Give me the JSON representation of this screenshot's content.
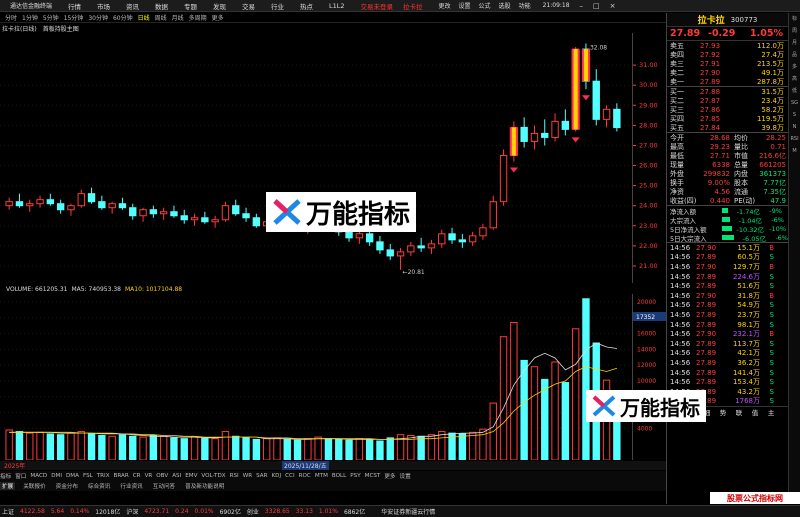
{
  "menu": {
    "app": "通达信金融终端",
    "items": [
      "行情",
      "市场",
      "资讯",
      "数据",
      "专题",
      "发现",
      "交易",
      "行业",
      "热点",
      "L1L2"
    ],
    "trade": "交易未登录",
    "stock": "拉卡拉",
    "right": [
      "更改",
      "设置",
      "公式",
      "选股",
      "功能"
    ],
    "time": "21:09:18"
  },
  "periods": [
    "分时",
    "1分钟",
    "5分钟",
    "15分钟",
    "30分钟",
    "60分钟",
    "日线",
    "周线",
    "月线",
    "多周期",
    "更多"
  ],
  "title": {
    "name": "拉卡拉(日线)",
    "tag": "首板持股主图"
  },
  "volume_header": {
    "vol": "VOLUME: 661205.31",
    "ma5": "MA5: 740953.38",
    "ma10": "MA10: 1017104.88"
  },
  "chart_data": [
    {
      "type": "candlestick",
      "title": "拉卡拉(日线)",
      "y_ticks": [
        31,
        30,
        29,
        28,
        27,
        26,
        25,
        24,
        23,
        22,
        21
      ],
      "ylim": [
        20.4,
        32.6
      ],
      "max_label": "32.08",
      "min_label": "20.81",
      "dates_label": [
        "2025年",
        "2025/11/28/五"
      ],
      "candles": [
        [
          24.0,
          24.4,
          23.8,
          24.2
        ],
        [
          24.2,
          24.6,
          23.9,
          24.0
        ],
        [
          24.0,
          24.3,
          23.7,
          24.1
        ],
        [
          24.1,
          24.5,
          23.9,
          24.3
        ],
        [
          24.3,
          24.6,
          24.0,
          24.1
        ],
        [
          24.1,
          24.3,
          23.6,
          23.8
        ],
        [
          23.8,
          24.1,
          23.5,
          24.0
        ],
        [
          24.0,
          24.8,
          23.9,
          24.6
        ],
        [
          24.6,
          24.9,
          24.1,
          24.2
        ],
        [
          24.2,
          24.5,
          23.8,
          23.9
        ],
        [
          23.9,
          24.2,
          23.6,
          24.1
        ],
        [
          24.1,
          24.4,
          23.8,
          23.9
        ],
        [
          23.9,
          24.1,
          23.3,
          23.5
        ],
        [
          23.5,
          23.9,
          23.2,
          23.8
        ],
        [
          23.8,
          24.0,
          23.4,
          23.6
        ],
        [
          23.6,
          23.9,
          23.3,
          23.7
        ],
        [
          23.7,
          24.0,
          23.4,
          23.5
        ],
        [
          23.5,
          23.8,
          23.1,
          23.3
        ],
        [
          23.3,
          23.6,
          23.0,
          23.4
        ],
        [
          23.4,
          23.7,
          23.1,
          23.2
        ],
        [
          23.2,
          23.5,
          22.9,
          23.3
        ],
        [
          23.3,
          24.2,
          23.2,
          24.0
        ],
        [
          24.0,
          24.3,
          23.5,
          23.6
        ],
        [
          23.6,
          23.9,
          23.2,
          23.4
        ],
        [
          23.4,
          23.6,
          22.9,
          23.0
        ],
        [
          23.0,
          23.4,
          22.8,
          23.2
        ],
        [
          23.2,
          23.5,
          22.9,
          23.3
        ],
        [
          23.3,
          23.6,
          23.0,
          23.1
        ],
        [
          23.1,
          23.4,
          22.7,
          22.9
        ],
        [
          22.9,
          23.3,
          22.6,
          23.1
        ],
        [
          23.1,
          23.6,
          22.9,
          23.4
        ],
        [
          23.4,
          23.7,
          23.0,
          23.2
        ],
        [
          23.2,
          23.4,
          22.5,
          22.7
        ],
        [
          22.7,
          23.0,
          22.2,
          22.4
        ],
        [
          22.4,
          22.8,
          22.1,
          22.6
        ],
        [
          22.6,
          22.9,
          22.0,
          22.2
        ],
        [
          22.2,
          22.5,
          21.6,
          21.8
        ],
        [
          21.8,
          22.1,
          21.3,
          21.5
        ],
        [
          21.5,
          21.9,
          20.81,
          21.7
        ],
        [
          21.7,
          22.2,
          21.5,
          22.0
        ],
        [
          22.0,
          22.4,
          21.7,
          21.9
        ],
        [
          21.9,
          22.3,
          21.6,
          22.1
        ],
        [
          22.1,
          22.8,
          21.9,
          22.6
        ],
        [
          22.6,
          22.9,
          22.1,
          22.3
        ],
        [
          22.3,
          22.6,
          21.9,
          22.2
        ],
        [
          22.2,
          22.7,
          22.0,
          22.5
        ],
        [
          22.5,
          23.1,
          22.3,
          22.9
        ],
        [
          22.9,
          24.5,
          22.8,
          24.2
        ],
        [
          24.2,
          26.8,
          24.0,
          26.5
        ],
        [
          26.5,
          28.2,
          26.2,
          27.9
        ],
        [
          27.9,
          28.4,
          26.9,
          27.2
        ],
        [
          27.2,
          28.0,
          26.8,
          27.6
        ],
        [
          27.6,
          28.3,
          27.0,
          27.4
        ],
        [
          27.4,
          28.6,
          27.2,
          28.2
        ],
        [
          28.2,
          28.8,
          27.5,
          27.8
        ],
        [
          27.8,
          31.9,
          27.7,
          31.8
        ],
        [
          31.8,
          32.08,
          29.8,
          30.2
        ],
        [
          30.2,
          30.8,
          28.0,
          28.3
        ],
        [
          28.3,
          29.0,
          27.9,
          28.8
        ],
        [
          28.8,
          29.1,
          27.7,
          27.89
        ]
      ]
    },
    {
      "type": "bar",
      "title": "VOLUME",
      "y_ticks": [
        20000,
        18000,
        16000,
        14000,
        12000,
        10000,
        8000,
        6000,
        4000
      ],
      "ylim": [
        0,
        21000
      ],
      "tag_value": "17352",
      "values": [
        3800,
        3600,
        3400,
        3500,
        3300,
        3200,
        3400,
        3600,
        3300,
        3100,
        3000,
        3200,
        3000,
        2900,
        3100,
        3000,
        2800,
        2700,
        2900,
        2800,
        2700,
        3600,
        3000,
        2800,
        2600,
        2700,
        2800,
        2600,
        2500,
        2700,
        2900,
        2700,
        2600,
        2500,
        2700,
        2600,
        2400,
        2800,
        3200,
        3100,
        3000,
        3200,
        3600,
        3400,
        3300,
        3500,
        3900,
        7200,
        15600,
        17400,
        12600,
        11800,
        10200,
        12400,
        9800,
        16600,
        20400,
        14800,
        10100,
        8600
      ],
      "ma5": [
        3500,
        3500,
        3500,
        3500,
        3500,
        3400,
        3400,
        3400,
        3400,
        3300,
        3300,
        3300,
        3200,
        3100,
        3000,
        3000,
        2900,
        2900,
        2900,
        2800,
        2800,
        2900,
        2900,
        2900,
        2900,
        2700,
        2700,
        2700,
        2600,
        2600,
        2700,
        2700,
        2700,
        2600,
        2600,
        2600,
        2600,
        2600,
        2700,
        2800,
        3000,
        3000,
        3200,
        3300,
        3400,
        3400,
        3500,
        4200,
        6600,
        9500,
        11300,
        12900,
        13500,
        12900,
        11400,
        12100,
        13900,
        14800,
        14300,
        14100
      ],
      "ma10": [
        3500,
        3500,
        3500,
        3500,
        3500,
        3500,
        3500,
        3400,
        3400,
        3400,
        3400,
        3300,
        3300,
        3200,
        3200,
        3100,
        3100,
        3000,
        3000,
        2900,
        2900,
        2900,
        2900,
        2900,
        2900,
        2800,
        2800,
        2800,
        2700,
        2700,
        2700,
        2700,
        2700,
        2700,
        2700,
        2700,
        2600,
        2600,
        2600,
        2600,
        2700,
        2700,
        2800,
        2900,
        3000,
        3100,
        3200,
        3600,
        4700,
        6200,
        7300,
        8200,
        8900,
        9600,
        10000,
        11200,
        11800,
        11500,
        11200,
        11600
      ]
    }
  ],
  "indicators": [
    "指标",
    "窗口",
    "MACD",
    "DMI",
    "DMA",
    "FSL",
    "TRIX",
    "BRAR",
    "CR",
    "VR",
    "OBV",
    "ASI",
    "EMV",
    "VOL-TDX",
    "RSI",
    "WR",
    "SAR",
    "KDJ",
    "CCI",
    "ROC",
    "MTM",
    "BOLL",
    "PSY",
    "MCST",
    "更多",
    "设置"
  ],
  "tabs": [
    "扩展",
    "关联报价",
    "资金分布",
    "综合资讯",
    "行业资讯",
    "互动问答",
    "普及新功能说明"
  ],
  "quote": {
    "name": "拉卡拉",
    "code": "300773",
    "price": "27.89",
    "change": "-0.29",
    "pct": "1.05%",
    "asks": [
      [
        "卖五",
        "27.93",
        "112.0万"
      ],
      [
        "卖四",
        "27.92",
        "27.4万"
      ],
      [
        "卖三",
        "27.91",
        "213.5万"
      ],
      [
        "卖二",
        "27.90",
        "49.1万"
      ],
      [
        "卖一",
        "27.89",
        "287.8万"
      ]
    ],
    "bids": [
      [
        "买一",
        "27.88",
        "31.5万"
      ],
      [
        "买二",
        "27.87",
        "23.4万"
      ],
      [
        "买三",
        "27.86",
        "58.2万"
      ],
      [
        "买四",
        "27.85",
        "119.5万"
      ],
      [
        "买五",
        "27.84",
        "39.8万"
      ]
    ],
    "stats": [
      [
        "今开",
        "28.68",
        "均价",
        "28.25"
      ],
      [
        "最高",
        "29.23",
        "量比",
        "0.71"
      ],
      [
        "最低",
        "27.71",
        "市值",
        "216.6亿"
      ],
      [
        "现量",
        "6338",
        "总量",
        "661205"
      ],
      [
        "外盘",
        "299832",
        "内盘",
        "361373"
      ],
      [
        "换手",
        "9.00%",
        "股本",
        "7.77亿"
      ],
      [
        "净资",
        "4.56",
        "流通",
        "7.35亿"
      ],
      [
        "收益(四)",
        "0.440",
        "PE(动)",
        "47.9"
      ]
    ],
    "flows": [
      [
        "净流入额",
        "-1.74亿",
        "-9%"
      ],
      [
        "大宗流入",
        "-1.04亿",
        "-6%"
      ],
      [
        "5日净流入额",
        "-10.32亿",
        "-10%"
      ],
      [
        "5日大宗流入",
        "-6.05亿",
        "-6%"
      ]
    ],
    "trades": [
      [
        "14:56",
        "27.90",
        "15.1万",
        "B"
      ],
      [
        "14:56",
        "27.89",
        "60.5万",
        "S"
      ],
      [
        "14:56",
        "27.90",
        "129.7万",
        "B"
      ],
      [
        "14:56",
        "27.89",
        "224.6万",
        "S"
      ],
      [
        "14:56",
        "27.89",
        "51.6万",
        "S"
      ],
      [
        "14:56",
        "27.90",
        "31.8万",
        "B"
      ],
      [
        "14:56",
        "27.89",
        "54.9万",
        "S"
      ],
      [
        "14:56",
        "27.89",
        "23.7万",
        "S"
      ],
      [
        "14:56",
        "27.89",
        "98.1万",
        "S"
      ],
      [
        "14:56",
        "27.90",
        "232.1万",
        "B"
      ],
      [
        "14:56",
        "27.89",
        "113.7万",
        "S"
      ],
      [
        "14:56",
        "27.89",
        "42.1万",
        "S"
      ],
      [
        "14:56",
        "27.89",
        "36.2万",
        "S"
      ],
      [
        "14:56",
        "27.89",
        "141.4万",
        "S"
      ],
      [
        "14:56",
        "27.89",
        "153.4万",
        "S"
      ],
      [
        "14:56",
        "27.89",
        "43.2万",
        "S"
      ],
      [
        "15:00",
        "27.89",
        "1768万",
        "S"
      ]
    ],
    "bottom_tabs": [
      "笔",
      "价",
      "细",
      "势",
      "联",
      "值",
      "主"
    ],
    "side_tabs": [
      "日线",
      "分时"
    ]
  },
  "status": {
    "sh": "上证",
    "sh_v": "4122.58",
    "sh_c": "5.64",
    "sh_p": "0.14%",
    "sh_a": "12018亿",
    "sz": "沪深",
    "sz_v": "4723.71",
    "sz_c": "0.24",
    "sz_p": "0.01%",
    "sz_a": "6902亿",
    "cy": "创业",
    "cy_v": "3328.65",
    "cy_c": "33.13",
    "cy_p": "1.01%",
    "cy_a": "6862亿",
    "broker": "华安证券新疆云行情"
  },
  "watermark": {
    "text": "万能指标",
    "site": "公式网 www.gszx.com.cn",
    "banner": "股票公式指标网"
  },
  "tools": [
    "标",
    "周",
    "月",
    "品",
    "多",
    "高",
    "低",
    "SG",
    "S",
    "N",
    "RSI",
    "M"
  ]
}
